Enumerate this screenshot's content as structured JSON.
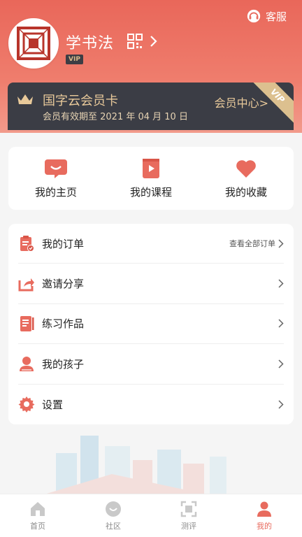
{
  "header": {
    "service_label": "客服",
    "username": "学书法",
    "vip_badge": "VIP"
  },
  "member_card": {
    "title": "国字云会员卡",
    "expiry": "会员有效期至 2021 年 04 月 10 日",
    "center_link": "会员中心>",
    "corner_tag": "VIP"
  },
  "quick_links": [
    {
      "label": "我的主页",
      "icon": "chat-bubble-icon"
    },
    {
      "label": "我的课程",
      "icon": "play-book-icon"
    },
    {
      "label": "我的收藏",
      "icon": "heart-icon"
    }
  ],
  "menu": [
    {
      "label": "我的订单",
      "extra": "查看全部订单",
      "icon": "clipboard-order-icon"
    },
    {
      "label": "邀请分享",
      "icon": "share-icon"
    },
    {
      "label": "练习作品",
      "icon": "notebook-icon"
    },
    {
      "label": "我的孩子",
      "icon": "child-icon"
    },
    {
      "label": "设置",
      "icon": "gear-icon"
    }
  ],
  "tabs": [
    {
      "label": "首页",
      "icon": "home-icon"
    },
    {
      "label": "社区",
      "icon": "community-icon"
    },
    {
      "label": "测评",
      "icon": "scan-icon"
    },
    {
      "label": "我的",
      "icon": "person-icon",
      "active": true
    }
  ],
  "colors": {
    "accent": "#e86b5e",
    "card_bg": "#3b3d45",
    "gold": "#e8c99a"
  }
}
